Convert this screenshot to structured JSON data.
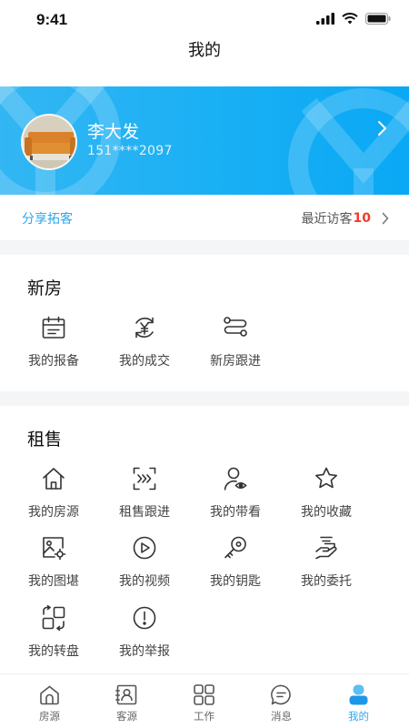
{
  "status_bar": {
    "time": "9:41"
  },
  "nav": {
    "title": "我的"
  },
  "profile": {
    "name": "李大发",
    "phone": "151****2097"
  },
  "share": {
    "link_label": "分享拓客",
    "recent_label": "最近访客",
    "recent_count": "10"
  },
  "new_house": {
    "title": "新房",
    "items": [
      {
        "label": "我的报备",
        "icon": "calendar-icon"
      },
      {
        "label": "我的成交",
        "icon": "yuan-exchange-icon"
      },
      {
        "label": "新房跟进",
        "icon": "follow-flow-icon"
      }
    ]
  },
  "rent_sale": {
    "title": "租售",
    "items": [
      {
        "label": "我的房源",
        "icon": "house-icon"
      },
      {
        "label": "租售跟进",
        "icon": "scan-forward-icon"
      },
      {
        "label": "我的带看",
        "icon": "person-eye-icon"
      },
      {
        "label": "我的收藏",
        "icon": "star-icon"
      },
      {
        "label": "我的图堪",
        "icon": "photo-settings-icon"
      },
      {
        "label": "我的视频",
        "icon": "play-circle-icon"
      },
      {
        "label": "我的钥匙",
        "icon": "key-icon"
      },
      {
        "label": "我的委托",
        "icon": "hand-document-icon"
      },
      {
        "label": "我的转盘",
        "icon": "transfer-icon"
      },
      {
        "label": "我的举报",
        "icon": "alert-circle-icon"
      }
    ]
  },
  "tabbar": {
    "tabs": [
      {
        "label": "房源",
        "icon": "house-tab-icon"
      },
      {
        "label": "客源",
        "icon": "contact-card-icon"
      },
      {
        "label": "工作",
        "icon": "grid-apps-icon"
      },
      {
        "label": "消息",
        "icon": "message-bubble-icon"
      },
      {
        "label": "我的",
        "icon": "user-tab-icon"
      }
    ],
    "active_index": 4
  },
  "colors": {
    "accent": "#2aa8ef",
    "hero_start": "#33b6f3",
    "hero_end": "#0aa8f5",
    "badge_red": "#ef3b2c"
  }
}
